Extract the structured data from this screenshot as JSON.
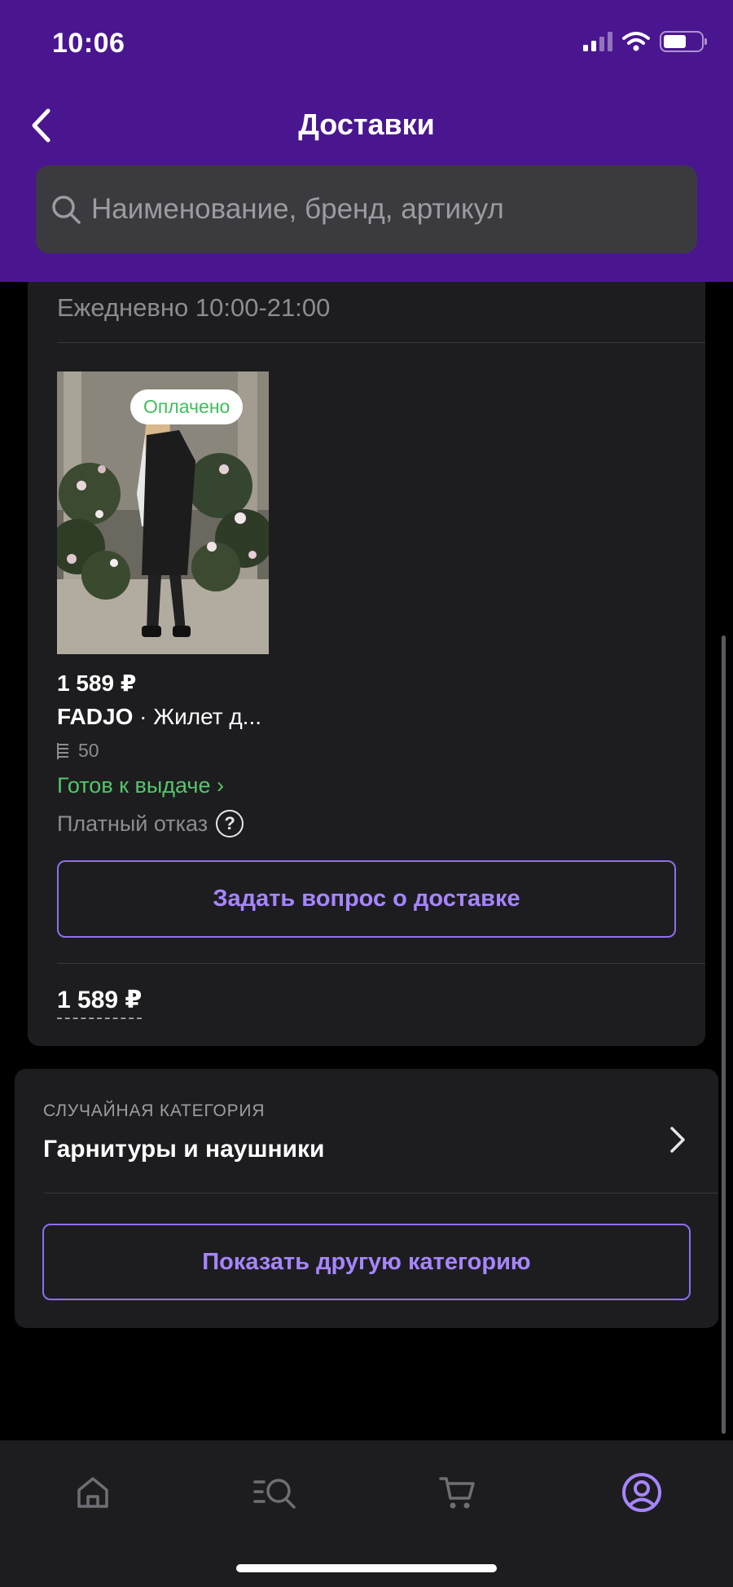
{
  "status_bar": {
    "time": "10:06"
  },
  "header": {
    "title": "Доставки"
  },
  "search": {
    "placeholder": "Наименование, бренд, артикул"
  },
  "delivery": {
    "hours": "Ежедневно 10:00-21:00",
    "product": {
      "badge": "Оплачено",
      "price": "1 589 ₽",
      "brand": "FADJO",
      "name": "· Жилет д...",
      "quantity": "50",
      "status": "Готов к выдаче ›",
      "paid_refusal": "Платный отказ"
    },
    "ask_button": "Задать вопрос о доставке",
    "total": "1 589 ₽"
  },
  "random_category": {
    "caption": "СЛУЧАЙНАЯ КАТЕГОРИЯ",
    "name": "Гарнитуры и наушники",
    "button": "Показать другую категорию"
  },
  "tabs": [
    {
      "icon": "home-icon",
      "active": false
    },
    {
      "icon": "catalog-search-icon",
      "active": false
    },
    {
      "icon": "cart-icon",
      "active": false
    },
    {
      "icon": "profile-icon",
      "active": true
    }
  ],
  "colors": {
    "header": "#4a1690",
    "accent": "#a685ff",
    "success": "#55c66a",
    "surface": "#1d1d20",
    "background": "#000000"
  }
}
